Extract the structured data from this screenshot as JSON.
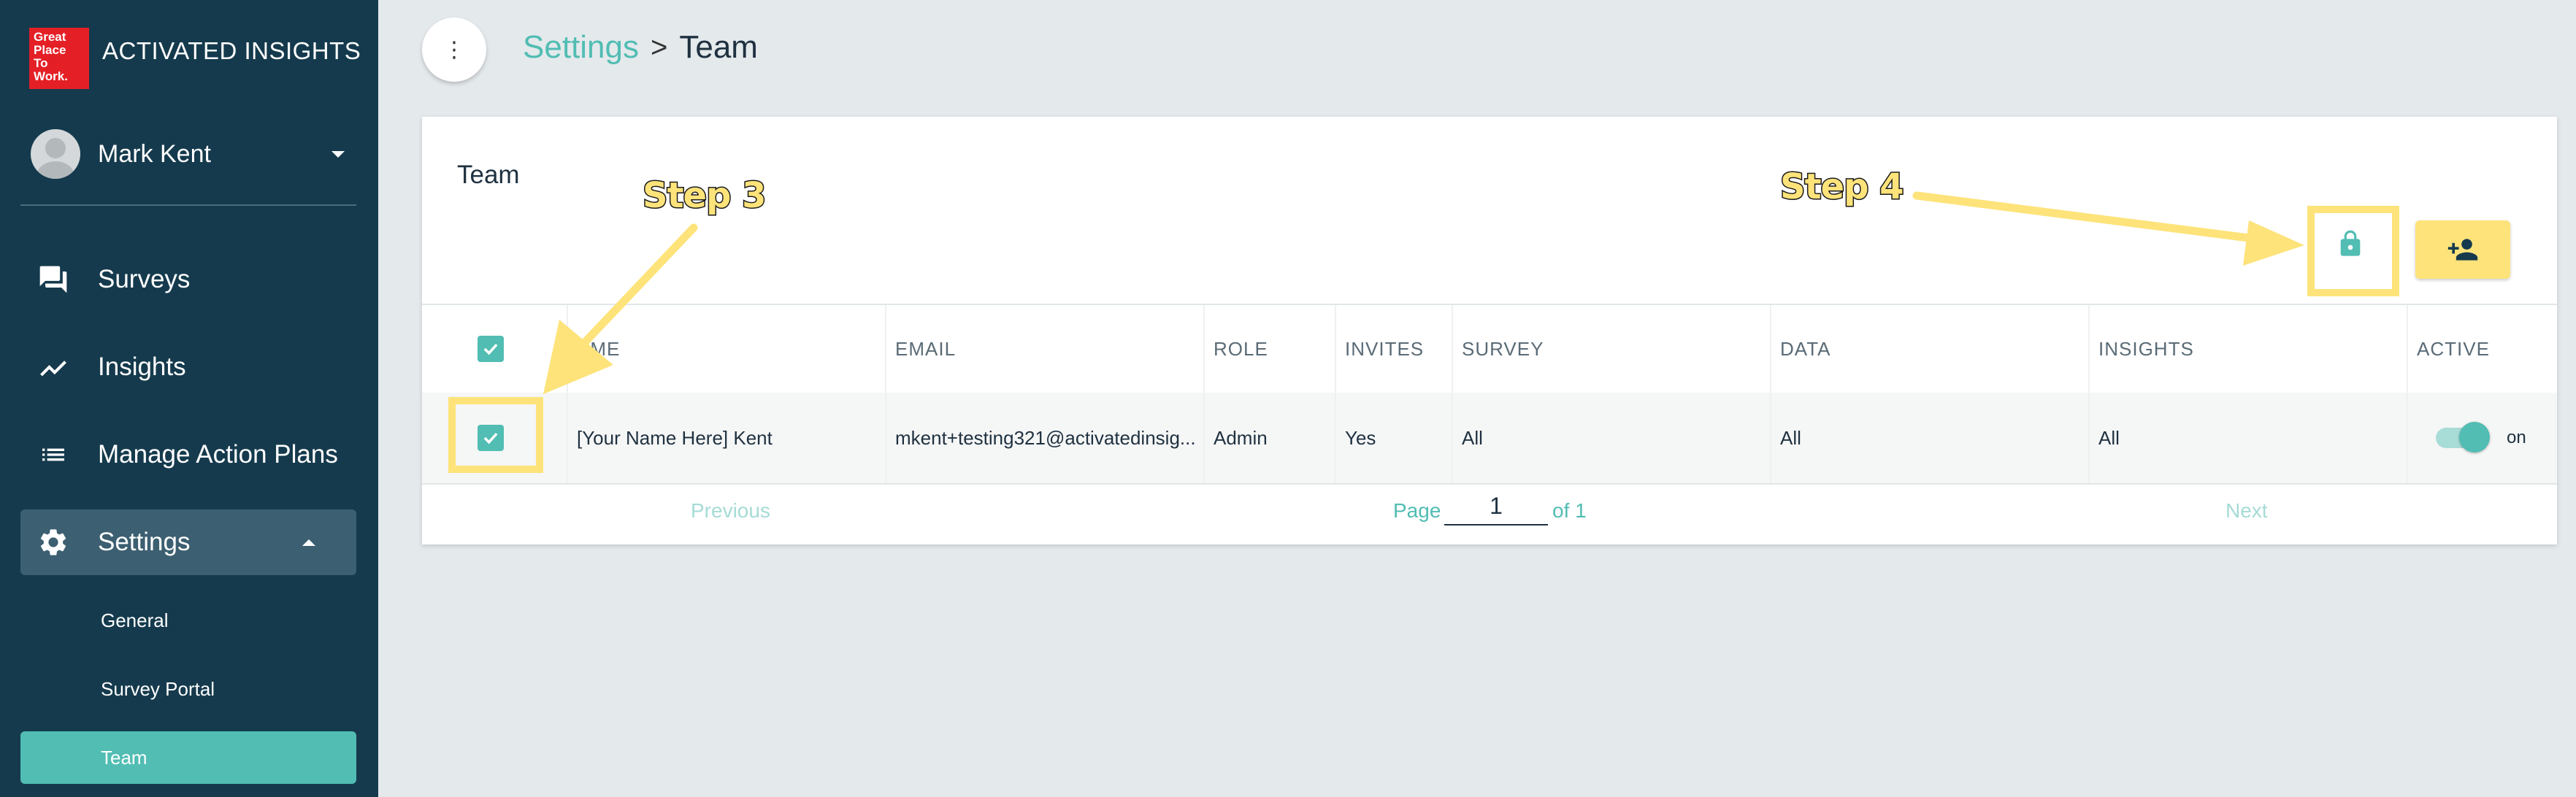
{
  "sidebar": {
    "logo_lines": [
      "Great",
      "Place",
      "To",
      "Work."
    ],
    "brand": "ACTIVATED INSIGHTS",
    "user_name": "Mark Kent",
    "nav": [
      {
        "label": "Surveys",
        "icon": "chat-icon"
      },
      {
        "label": "Insights",
        "icon": "trend-icon"
      },
      {
        "label": "Manage Action Plans",
        "icon": "list-icon"
      },
      {
        "label": "Settings",
        "icon": "gear-icon"
      }
    ],
    "sub_items": [
      "General",
      "Survey Portal",
      "Team"
    ]
  },
  "breadcrumb": {
    "parent": "Settings",
    "separator": ">",
    "current": "Team"
  },
  "card": {
    "title": "Team"
  },
  "table": {
    "headers": [
      "NAME",
      "EMAIL",
      "ROLE",
      "INVITES",
      "SURVEY",
      "DATA",
      "INSIGHTS",
      "ACTIVE"
    ],
    "header_name_visible": "AME",
    "row": {
      "name": "[Your Name Here] Kent",
      "email": "mkent+testing321@activatedinsig...",
      "role": "Admin",
      "invites": "Yes",
      "survey": "All",
      "data": "All",
      "insights": "All",
      "active": "on"
    }
  },
  "pager": {
    "prev": "Previous",
    "page_label": "Page",
    "page_value": "1",
    "of_label": "of 1",
    "next": "Next"
  },
  "annotations": {
    "step3": "Step 3",
    "step4": "Step 4"
  },
  "colors": {
    "sidebar": "#153a4d",
    "accent": "#51bdb3",
    "highlight": "#fde37a",
    "background": "#e4e9ec"
  }
}
